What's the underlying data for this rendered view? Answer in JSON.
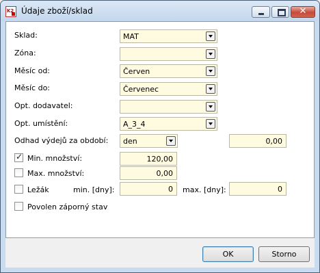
{
  "window": {
    "title": "Údaje zboží/sklad"
  },
  "fields": {
    "sklad": {
      "label": "Sklad:",
      "value": "MAT"
    },
    "zona": {
      "label": "Zóna:",
      "value": ""
    },
    "mesic_od": {
      "label": "Měsíc od:",
      "value": "Červen"
    },
    "mesic_do": {
      "label": "Měsíc do:",
      "value": "Červenec"
    },
    "opt_dodavatel": {
      "label": "Opt. dodavatel:",
      "value": ""
    },
    "opt_umisteni": {
      "label": "Opt. umístění:",
      "value": "A_3_4"
    },
    "odhad": {
      "label": "Odhad výdejů za období:",
      "period": "den",
      "value": "0,00"
    },
    "min_mnozstvi": {
      "label": "Min. množství:",
      "checked": true,
      "value": "120,00"
    },
    "max_mnozstvi": {
      "label": "Max. množství:",
      "checked": false,
      "value": "0,00"
    },
    "lezak": {
      "label": "Ležák",
      "checked": false,
      "min_label": "min. [dny]:",
      "min_value": "0",
      "max_label": "max. [dny]:",
      "max_value": "0"
    },
    "povolen": {
      "label": "Povolen záporný stav",
      "checked": false
    }
  },
  "buttons": {
    "ok": "OK",
    "storno": "Storno"
  },
  "icons": {
    "app": "k2-app-icon",
    "dropdown": "chevron-down-icon",
    "check": "checkmark-icon"
  }
}
